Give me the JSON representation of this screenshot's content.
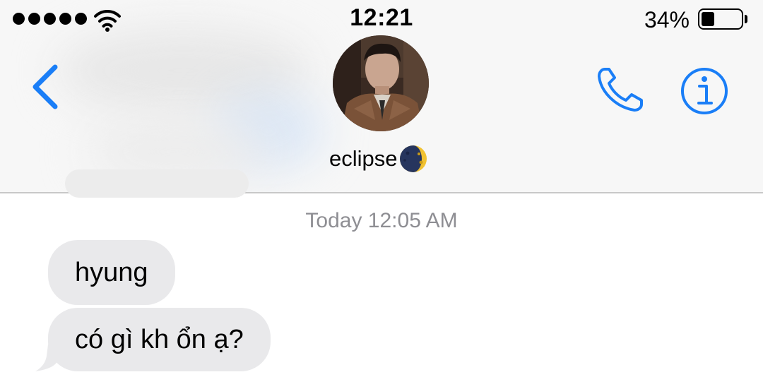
{
  "status_bar": {
    "signal_bars": 5,
    "wifi_icon": "wifi-icon",
    "time": "12:21",
    "battery_percent": "34%",
    "battery_level": 0.34
  },
  "header": {
    "back_icon": "chevron-left-icon",
    "contact_name": "eclipse",
    "contact_emoji_icon": "crescent-moon-icon",
    "call_icon": "phone-icon",
    "info_icon": "info-icon",
    "accent_color": "#1a7ef7"
  },
  "conversation": {
    "timestamp": "Today 12:05 AM",
    "messages": [
      {
        "sender": "contact",
        "text": "hyung"
      },
      {
        "sender": "contact",
        "text": "có gì kh ổn ạ?"
      }
    ]
  },
  "colors": {
    "incoming_bubble": "#e9e9eb",
    "timestamp_text": "#8e8e93",
    "header_bg": "#f7f7f7"
  }
}
